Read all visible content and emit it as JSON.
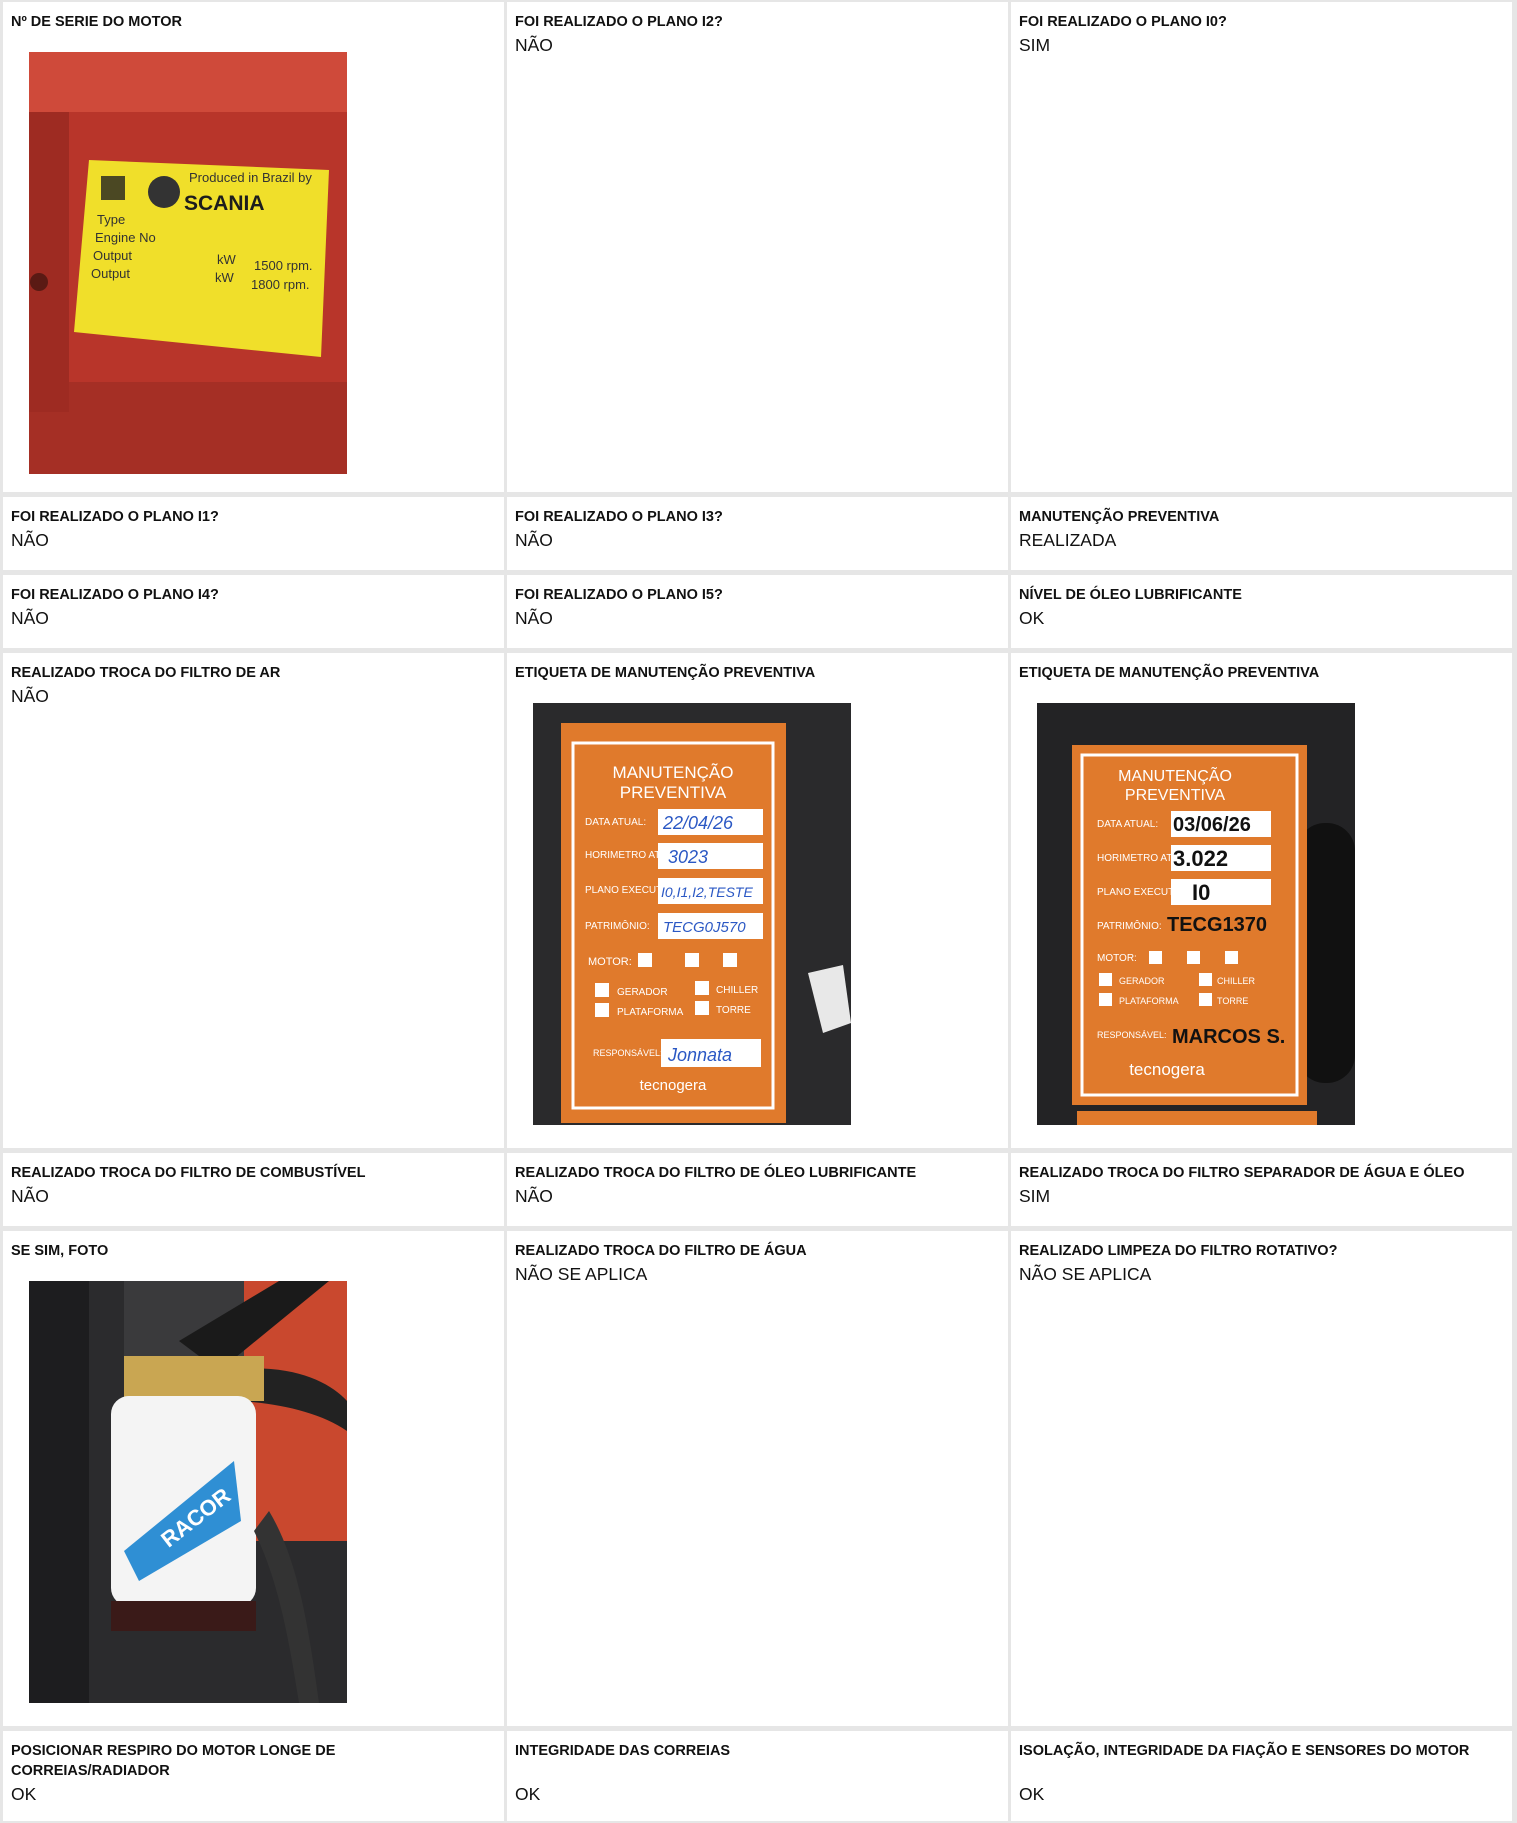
{
  "cells": [
    {
      "label": "Nº DE SERIE DO MOTOR",
      "value": "",
      "photo": "engine-plate"
    },
    {
      "label": "FOI REALIZADO O PLANO I2?",
      "value": "NÃO"
    },
    {
      "label": "FOI REALIZADO O PLANO I0?",
      "value": "SIM"
    },
    {
      "label": "FOI REALIZADO O PLANO I1?",
      "value": "NÃO"
    },
    {
      "label": "FOI REALIZADO O PLANO I3?",
      "value": "NÃO"
    },
    {
      "label": "MANUTENÇÃO PREVENTIVA",
      "value": "REALIZADA"
    },
    {
      "label": "FOI REALIZADO O PLANO I4?",
      "value": "NÃO"
    },
    {
      "label": "FOI REALIZADO O PLANO I5?",
      "value": "NÃO"
    },
    {
      "label": "NÍVEL DE ÓLEO LUBRIFICANTE",
      "value": "OK"
    },
    {
      "label": "REALIZADO TROCA DO FILTRO DE AR",
      "value": "NÃO"
    },
    {
      "label": "ETIQUETA DE MANUTENÇÃO PREVENTIVA",
      "value": "",
      "photo": "maintenance-tag-1"
    },
    {
      "label": "ETIQUETA DE MANUTENÇÃO PREVENTIVA",
      "value": "",
      "photo": "maintenance-tag-2"
    },
    {
      "label": "REALIZADO TROCA DO FILTRO DE COMBUSTÍVEL",
      "value": "NÃO"
    },
    {
      "label": "REALIZADO TROCA DO FILTRO DE ÓLEO LUBRIFICANTE",
      "value": "NÃO"
    },
    {
      "label": "REALIZADO TROCA DO FILTRO SEPARADOR DE ÁGUA E ÓLEO",
      "value": "SIM"
    },
    {
      "label": "SE SIM, FOTO",
      "value": "",
      "photo": "racor-filter"
    },
    {
      "label": "REALIZADO TROCA DO FILTRO DE ÁGUA",
      "value": "NÃO SE APLICA"
    },
    {
      "label": "REALIZADO LIMPEZA DO FILTRO ROTATIVO?",
      "value": "NÃO SE APLICA"
    },
    {
      "label": "POSICIONAR RESPIRO DO MOTOR LONGE DE CORREIAS/RADIADOR",
      "value": "OK"
    },
    {
      "label": "INTEGRIDADE DAS CORREIAS",
      "value": "OK"
    },
    {
      "label": "ISOLAÇÃO, INTEGRIDADE DA FIAÇÃO E SENSORES DO MOTOR",
      "value": "OK"
    }
  ],
  "photos": {
    "engine_plate": {
      "line1": "Produced in Brazil by",
      "brand": "SCANIA",
      "type_label": "Type",
      "engine_label": "Engine No",
      "output_label": "Output",
      "kw": "kW",
      "rpm1": "1500 rpm.",
      "rpm2": "1800 rpm."
    },
    "tag1": {
      "title1": "MANUTENÇÃO",
      "title2": "PREVENTIVA",
      "f1": "DATA ATUAL:",
      "v1": "22/04/26",
      "f2": "HORIMETRO ATUAL:",
      "v2": "3023",
      "f3": "PLANO EXECUTADO:",
      "v3": "I0,I1,I2,TESTE",
      "f4": "PATRIMÔNIO:",
      "v4": "TECG0J570",
      "f5": "MOTOR:",
      "f6": "GERADOR",
      "f7": "CHILLER",
      "f8": "PLATAFORMA",
      "f9": "TORRE",
      "f10": "RESPONSÁVEL:",
      "v10": "Jonnata",
      "brand": "tecnogera"
    },
    "tag2": {
      "title1": "MANUTENÇÃO",
      "title2": "PREVENTIVA",
      "f1": "DATA ATUAL:",
      "v1": "03/06/26",
      "f2": "HORIMETRO ATUAL:",
      "v2": "3.022",
      "f3": "PLANO EXECUTADO:",
      "v3": "I0",
      "f4": "PATRIMÔNIO:",
      "v4": "TECG1370",
      "f5": "MOTOR:",
      "f6": "GERADOR",
      "f7": "CHILLER",
      "f8": "PLATAFORMA",
      "f9": "TORRE",
      "f10": "RESPONSÁVEL:",
      "v10": "MARCOS S.",
      "brand": "tecnogera"
    },
    "racor": {
      "brand": "RACOR"
    }
  },
  "colors": {
    "tag_orange": "#e07a2c",
    "plate_yellow": "#f0df2a",
    "engine_red": "#c8402e",
    "racor_blue": "#2f8fd4"
  }
}
